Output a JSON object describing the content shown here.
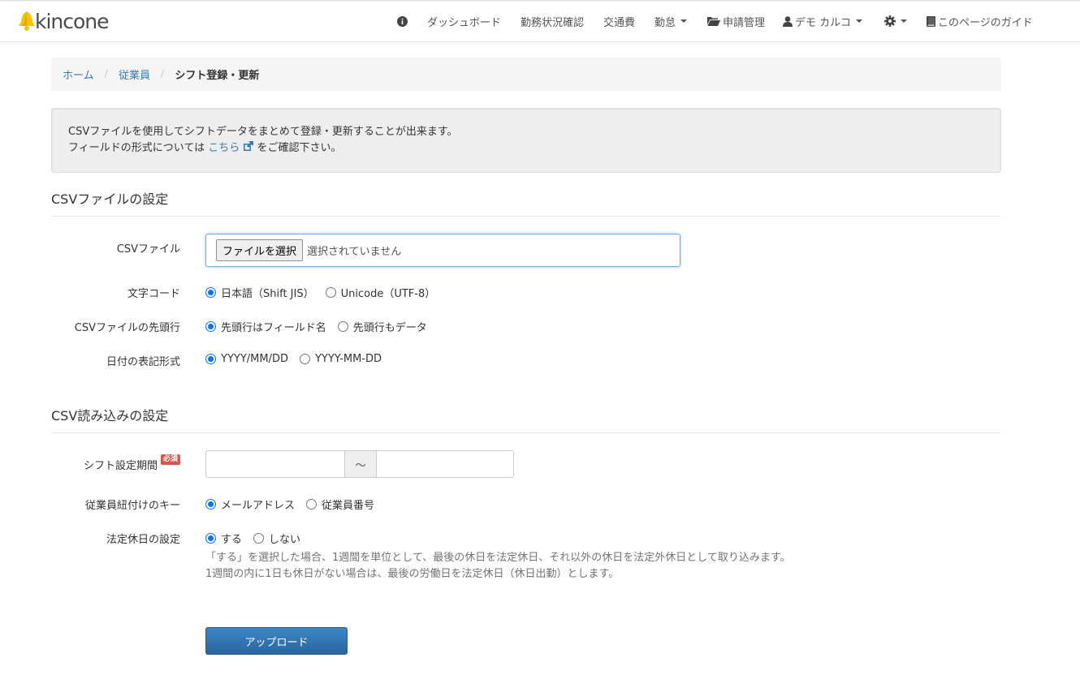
{
  "brand": {
    "name": "kincone",
    "accent": "#f5c400"
  },
  "nav": {
    "info_icon": "info-circle-icon",
    "dashboard": "ダッシュボード",
    "attendance_status": "勤務状況確認",
    "transport": "交通費",
    "kintai": "勤怠",
    "requests": "申請管理",
    "user": "デモ カルコ",
    "settings_icon": "gear-icon",
    "guide": "このページのガイド"
  },
  "breadcrumb": {
    "home": "ホーム",
    "employees": "従業員",
    "current": "シフト登録・更新",
    "sep": "/"
  },
  "info": {
    "line1": "CSVファイルを使用してシフトデータをまとめて登録・更新することが出来ます。",
    "line2_prefix": "フィールドの形式については",
    "link": "こちら",
    "line2_suffix": "をご確認下さい。"
  },
  "csv_settings": {
    "title": "CSVファイルの設定",
    "file": {
      "label": "CSVファイル",
      "button": "ファイルを選択",
      "status": "選択されていません"
    },
    "encoding": {
      "label": "文字コード",
      "options": [
        "日本語（Shift JIS）",
        "Unicode（UTF-8）"
      ],
      "selected": 0
    },
    "header_row": {
      "label": "CSVファイルの先頭行",
      "options": [
        "先頭行はフィールド名",
        "先頭行もデータ"
      ],
      "selected": 0
    },
    "date_format": {
      "label": "日付の表記形式",
      "options": [
        "YYYY/MM/DD",
        "YYYY-MM-DD"
      ],
      "selected": 0
    }
  },
  "import_settings": {
    "title": "CSV読み込みの設定",
    "period": {
      "label": "シフト設定期間",
      "badge": "必須",
      "separator": "〜",
      "start": "",
      "end": ""
    },
    "key": {
      "label": "従業員紐付けのキー",
      "options": [
        "メールアドレス",
        "従業員番号"
      ],
      "selected": 0
    },
    "legal_holiday": {
      "label": "法定休日の設定",
      "options": [
        "する",
        "しない"
      ],
      "selected": 0,
      "help1": "「する」を選択した場合、1週間を単位として、最後の休日を法定休日、それ以外の休日を法定外休日として取り込みます。",
      "help2": "1週間の内に1日も休日がない場合は、最後の労働日を法定休日（休日出勤）とします。"
    }
  },
  "upload": {
    "label": "アップロード"
  }
}
